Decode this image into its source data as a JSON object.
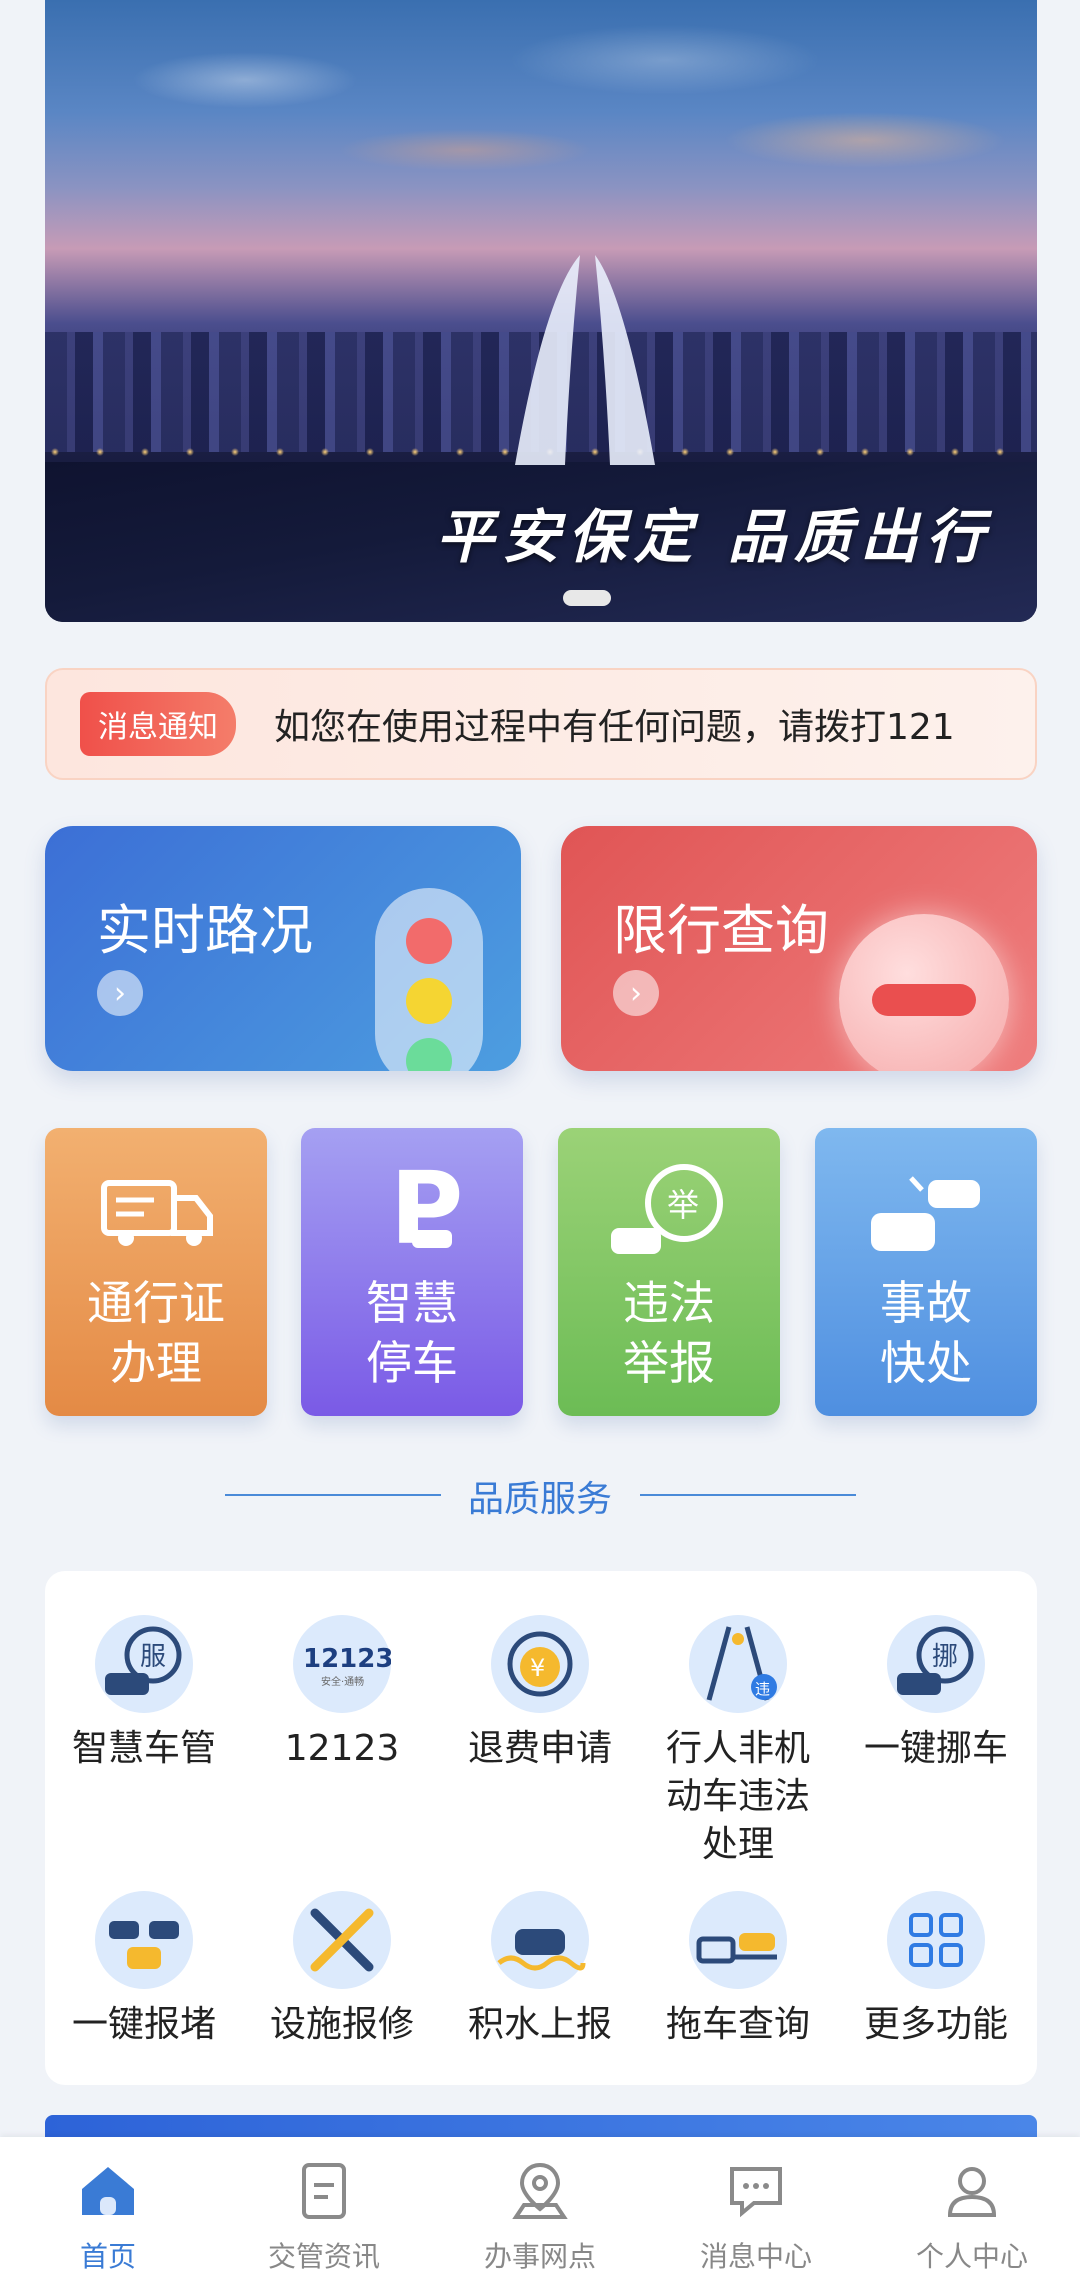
{
  "banner": {
    "slogan": "平安保定  品质出行"
  },
  "notice": {
    "tag": "消息通知",
    "text": "如您在使用过程中有任何问题，请拨打121"
  },
  "cards": [
    {
      "title": "实时路况"
    },
    {
      "title": "限行查询"
    }
  ],
  "tiles": [
    {
      "label": "通行证\n办理"
    },
    {
      "label": "智慧\n停车"
    },
    {
      "label": "违法\n举报"
    },
    {
      "label": "事故\n快处"
    }
  ],
  "section_title": "品质服务",
  "services": [
    {
      "label": "智慧车管",
      "icon": "car-service-icon"
    },
    {
      "label": "12123",
      "icon": "12123-logo-icon"
    },
    {
      "label": "退费申请",
      "icon": "refund-yuan-icon"
    },
    {
      "label": "行人非机动车违法处理",
      "icon": "pedestrian-violation-icon"
    },
    {
      "label": "一键挪车",
      "icon": "move-car-icon"
    },
    {
      "label": "一键报堵",
      "icon": "traffic-jam-icon"
    },
    {
      "label": "设施报修",
      "icon": "wrench-screwdriver-icon"
    },
    {
      "label": "积水上报",
      "icon": "waterlogging-icon"
    },
    {
      "label": "拖车查询",
      "icon": "tow-truck-icon"
    },
    {
      "label": "更多功能",
      "icon": "grid-icon"
    }
  ],
  "tile_texts": {
    "service_badge": "服",
    "logo_top": "12123",
    "logo_sub": "安全·通畅",
    "report_badge": "举",
    "violation_badge": "违",
    "move_badge": "挪",
    "yuan": "¥"
  },
  "nav": [
    {
      "label": "首页",
      "active": true
    },
    {
      "label": "交管资讯"
    },
    {
      "label": "办事网点"
    },
    {
      "label": "消息中心"
    },
    {
      "label": "个人中心"
    }
  ],
  "colors": {
    "accent": "#3a7bd5",
    "notice_tag": "#f0504a"
  }
}
